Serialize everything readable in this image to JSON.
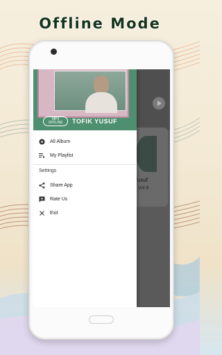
{
  "promo": {
    "title": "Offline Mode"
  },
  "drawer": {
    "header": {
      "badge_top": "MP3",
      "badge_bottom": "OFFLINE",
      "name": "TOFIK YUSUF"
    },
    "items": [
      {
        "label": "All Album",
        "icon": "album-icon"
      },
      {
        "label": "My Playlist",
        "icon": "playlist-icon"
      }
    ],
    "section": "Settings",
    "settings_items": [
      {
        "label": "Share App",
        "icon": "share-icon"
      },
      {
        "label": "Rate Us",
        "icon": "rate-icon"
      },
      {
        "label": "Exit",
        "icon": "close-icon"
      }
    ]
  },
  "behind": {
    "artist": "Yusuf",
    "album": "a Vol.8"
  },
  "colors": {
    "drawer_header": "#4d8f6f",
    "title_text": "#16331c",
    "scrim": "#5a5a5a"
  }
}
